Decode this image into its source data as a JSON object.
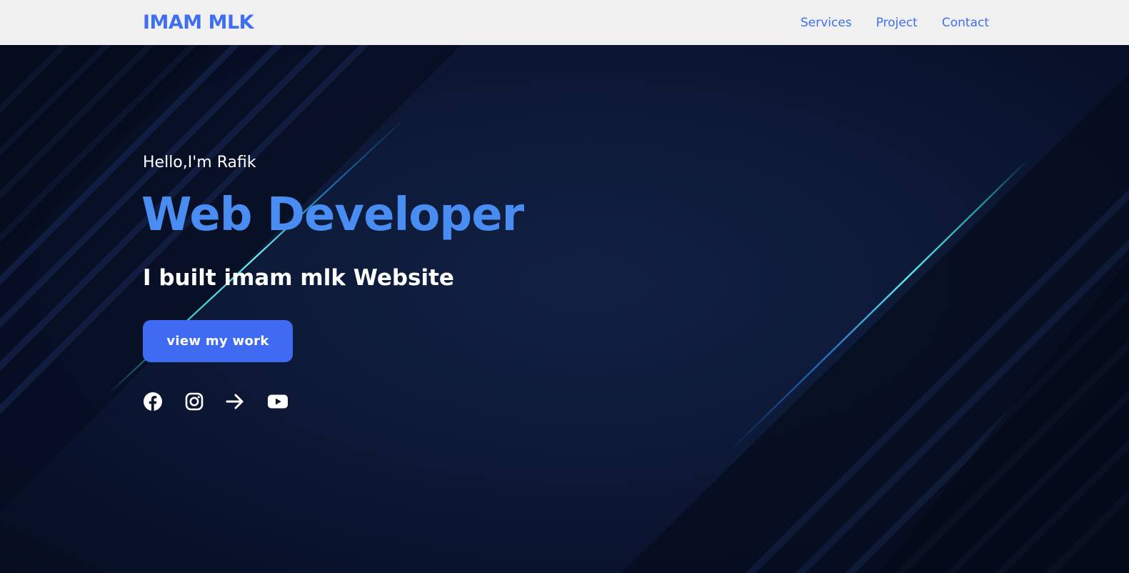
{
  "header": {
    "logo": "IMAM MLK",
    "nav": [
      {
        "label": "Services"
      },
      {
        "label": "Project"
      },
      {
        "label": "Contact"
      }
    ]
  },
  "hero": {
    "greeting": "Hello,I'm Rafik",
    "title": "Web Developer",
    "tagline": "I built imam mlk Website",
    "cta_label": "view my work"
  },
  "socials": [
    {
      "icon": "facebook-icon"
    },
    {
      "icon": "instagram-icon"
    },
    {
      "icon": "arrow-right-icon"
    },
    {
      "icon": "youtube-icon"
    }
  ],
  "colors": {
    "brand": "#3d6ff0",
    "title": "#4a8df2",
    "button": "#3e6bf2",
    "navbar_bg": "#f0f0f0",
    "hero_bg": "#0b1530",
    "accent_line": "#3ee0e6"
  }
}
